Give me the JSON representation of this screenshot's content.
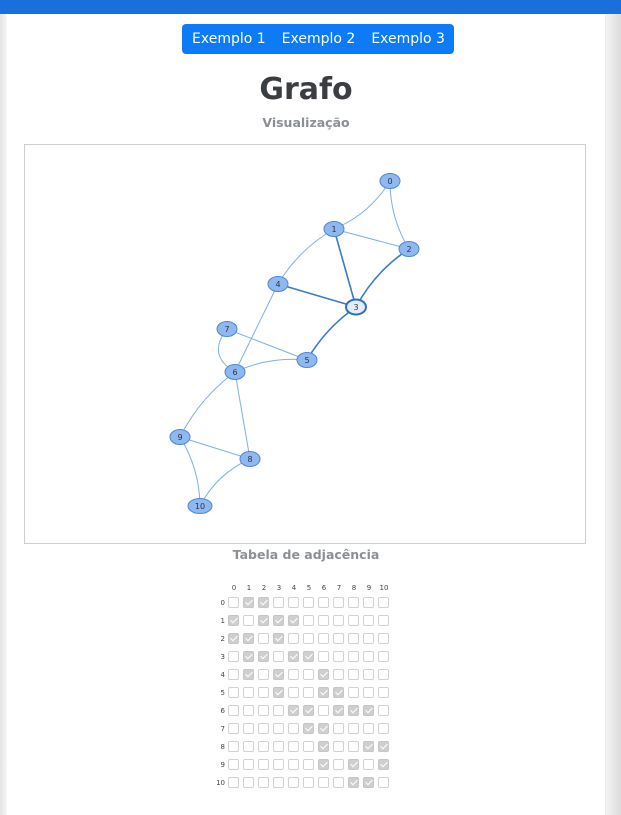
{
  "tabs": [
    {
      "label": "Exemplo 1"
    },
    {
      "label": "Exemplo 2"
    },
    {
      "label": "Exemplo 3"
    }
  ],
  "title": "Grafo",
  "subtitle": "Visualização",
  "table_title": "Tabela de adjacência",
  "colors": {
    "accent": "#0d7bf6",
    "node_fill": "#8fb8f0",
    "node_stroke": "#4d86d6",
    "edge": "#7fb0e2",
    "edge_strong": "#3a7bc8",
    "selected_node_fill": "#e4eefb"
  },
  "graph": {
    "nodes": [
      "0",
      "1",
      "2",
      "3",
      "4",
      "5",
      "6",
      "7",
      "8",
      "9",
      "10"
    ],
    "selected_node": "3",
    "edges": [
      [
        "0",
        "1"
      ],
      [
        "0",
        "2"
      ],
      [
        "1",
        "2"
      ],
      [
        "1",
        "3"
      ],
      [
        "1",
        "4"
      ],
      [
        "2",
        "3"
      ],
      [
        "3",
        "4"
      ],
      [
        "3",
        "5"
      ],
      [
        "4",
        "6"
      ],
      [
        "5",
        "6"
      ],
      [
        "5",
        "7"
      ],
      [
        "6",
        "7"
      ],
      [
        "6",
        "8"
      ],
      [
        "6",
        "9"
      ],
      [
        "8",
        "9"
      ],
      [
        "8",
        "10"
      ],
      [
        "9",
        "10"
      ]
    ]
  },
  "adjacency": {
    "headers": [
      "0",
      "1",
      "2",
      "3",
      "4",
      "5",
      "6",
      "7",
      "8",
      "9",
      "10"
    ],
    "rows": [
      [
        false,
        true,
        true,
        false,
        false,
        false,
        false,
        false,
        false,
        false,
        false
      ],
      [
        true,
        false,
        true,
        true,
        true,
        false,
        false,
        false,
        false,
        false,
        false
      ],
      [
        true,
        true,
        false,
        true,
        false,
        false,
        false,
        false,
        false,
        false,
        false
      ],
      [
        false,
        true,
        true,
        false,
        true,
        true,
        false,
        false,
        false,
        false,
        false
      ],
      [
        false,
        true,
        false,
        true,
        false,
        false,
        true,
        false,
        false,
        false,
        false
      ],
      [
        false,
        false,
        false,
        true,
        false,
        false,
        true,
        true,
        false,
        false,
        false
      ],
      [
        false,
        false,
        false,
        false,
        true,
        true,
        false,
        true,
        true,
        true,
        false
      ],
      [
        false,
        false,
        false,
        false,
        false,
        true,
        true,
        false,
        false,
        false,
        false
      ],
      [
        false,
        false,
        false,
        false,
        false,
        false,
        true,
        false,
        false,
        true,
        true
      ],
      [
        false,
        false,
        false,
        false,
        false,
        false,
        true,
        false,
        true,
        false,
        true
      ],
      [
        false,
        false,
        false,
        false,
        false,
        false,
        false,
        false,
        true,
        true,
        false
      ]
    ]
  }
}
